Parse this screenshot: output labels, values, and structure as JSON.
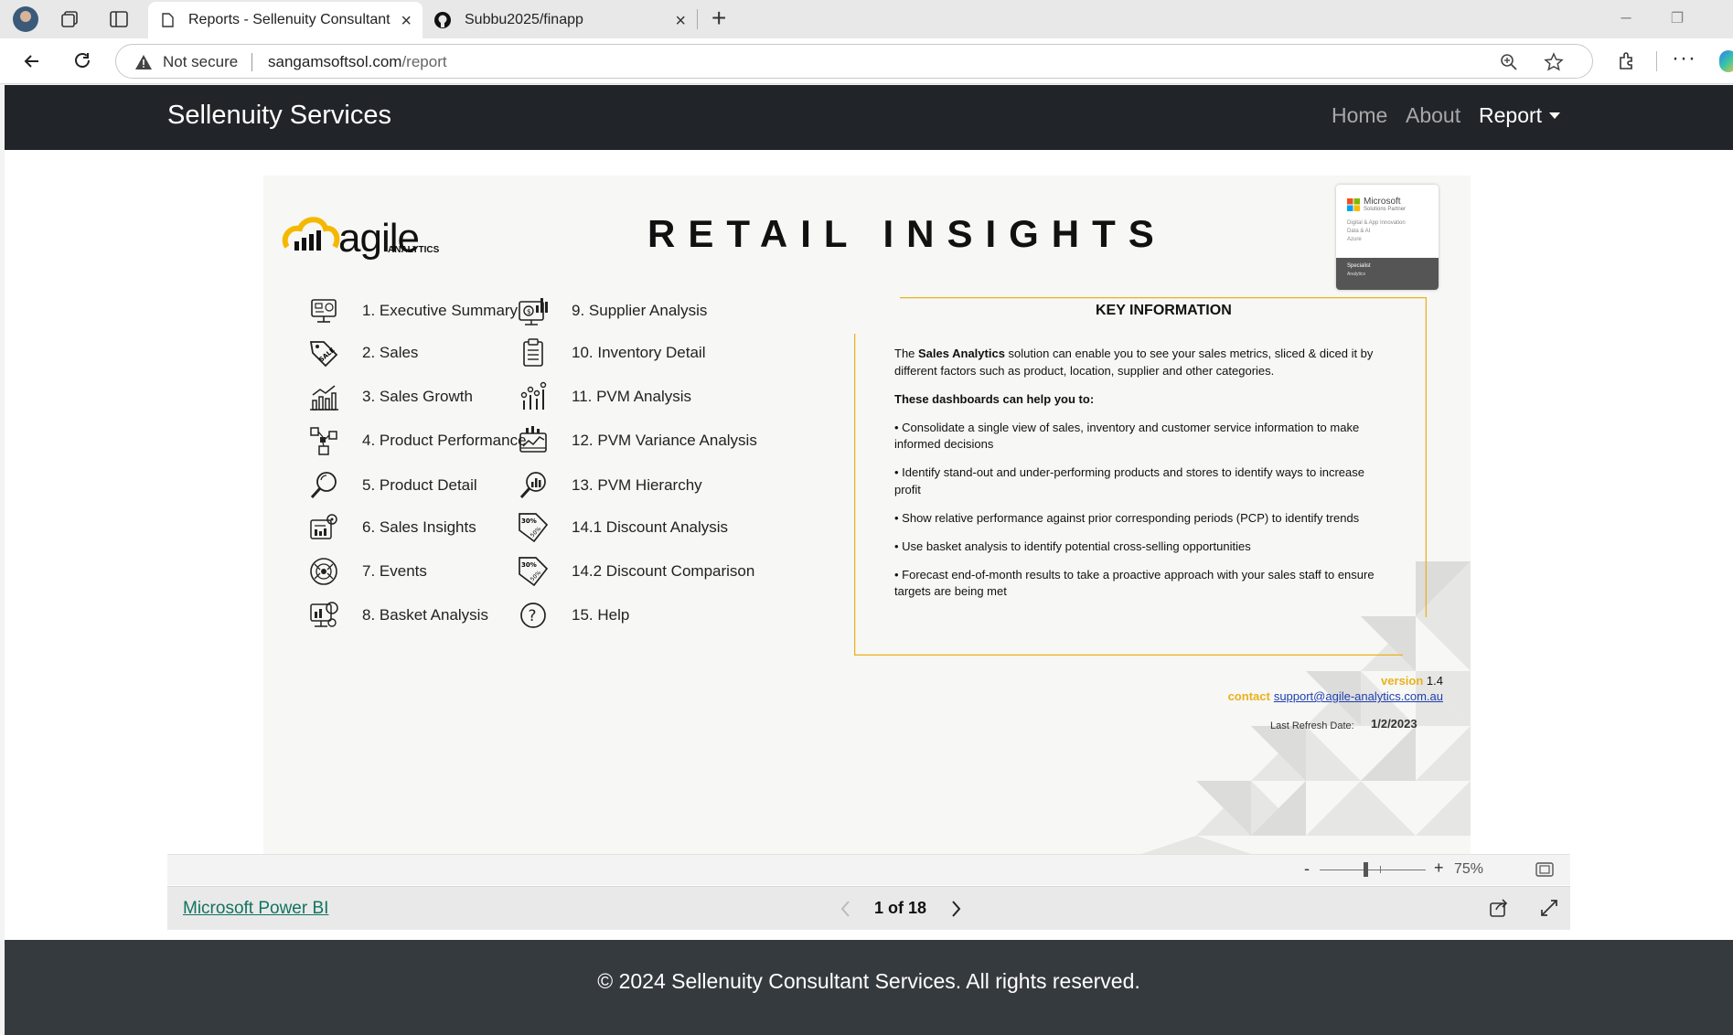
{
  "browser": {
    "tabs": [
      {
        "title": "Reports - Sellenuity Consultant Se",
        "icon": "page-icon"
      },
      {
        "title": "Subbu2025/finapp",
        "icon": "github-icon"
      }
    ],
    "security": "Not secure",
    "url_domain": "sangamsoftsol.com",
    "url_path": "/report"
  },
  "site": {
    "brand": "Sellenuity Services",
    "nav": {
      "home": "Home",
      "about": "About",
      "report": "Report"
    },
    "footer": "© 2024 Sellenuity Consultant Services. All rights reserved."
  },
  "report": {
    "logo_text": "agile",
    "logo_sub": "ANALYTICS",
    "title": "RETAIL   INSIGHTS",
    "badge": {
      "name": "Microsoft",
      "sub": "Solutions Partner",
      "lines": [
        "Digital & App Innovation",
        "Data & AI",
        "Azure"
      ],
      "foot1": "Specialist",
      "foot2": "Analytics"
    },
    "menu_left": [
      {
        "label": "1. Executive Summary",
        "icon": "dashboard-icon"
      },
      {
        "label": "2. Sales",
        "icon": "sale-tag-icon"
      },
      {
        "label": "3. Sales Growth",
        "icon": "growth-chart-icon"
      },
      {
        "label": "4. Product Performance",
        "icon": "product-network-icon"
      },
      {
        "label": "5. Product Detail",
        "icon": "magnifier-icon"
      },
      {
        "label": "6. Sales Insights",
        "icon": "insights-icon"
      },
      {
        "label": "7. Events",
        "icon": "events-icon"
      },
      {
        "label": "8. Basket Analysis",
        "icon": "basket-analysis-icon"
      }
    ],
    "menu_right": [
      {
        "label": "9. Supplier Analysis",
        "icon": "supplier-icon"
      },
      {
        "label": "10. Inventory Detail",
        "icon": "clipboard-icon"
      },
      {
        "label": "11. PVM Analysis",
        "icon": "pvm-chart-icon"
      },
      {
        "label": "12. PVM Variance Analysis",
        "icon": "variance-icon"
      },
      {
        "label": "13. PVM Hierarchy",
        "icon": "hierarchy-search-icon"
      },
      {
        "label": "14.1 Discount Analysis",
        "icon": "discount-tag-icon"
      },
      {
        "label": "14.2 Discount Comparison",
        "icon": "discount-compare-icon"
      },
      {
        "label": "15. Help",
        "icon": "help-icon"
      }
    ],
    "key_info": {
      "title": "KEY INFORMATION",
      "intro_pre": "The ",
      "intro_bold": "Sales Analytics",
      "intro_post": " solution can enable you to see your sales metrics, sliced & diced it by different factors such as product, location, supplier and other categories.",
      "help_heading": "These dashboards can help you to:",
      "bullets": [
        "• Consolidate a single view of sales, inventory and customer service information to make informed decisions",
        "• Identify stand-out and under-performing products and stores to identify ways to increase profit",
        "• Show relative performance against prior corresponding periods (PCP) to identify trends",
        "• Use basket analysis to identify potential cross-selling opportunities",
        "• Forecast end-of-month results to take a proactive approach with your sales staff to ensure targets are being met"
      ]
    },
    "version_label": "version",
    "version_value": "1.4",
    "contact_label": "contact",
    "contact_email": "support@agile-analytics.com.au",
    "refresh_label": "Last Refresh Date:",
    "refresh_value": "1/2/2023"
  },
  "viewer": {
    "zoom_minus": "-",
    "zoom_plus": "+",
    "zoom_pct": "75%",
    "zoom_level": 0.75,
    "pbi_link": "Microsoft Power BI",
    "page_indicator": "1 of 18"
  },
  "colors": {
    "accent_gold": "#e8b21e",
    "navbar": "#212529",
    "footer": "#353a3f",
    "pbi_link": "#12735f"
  }
}
